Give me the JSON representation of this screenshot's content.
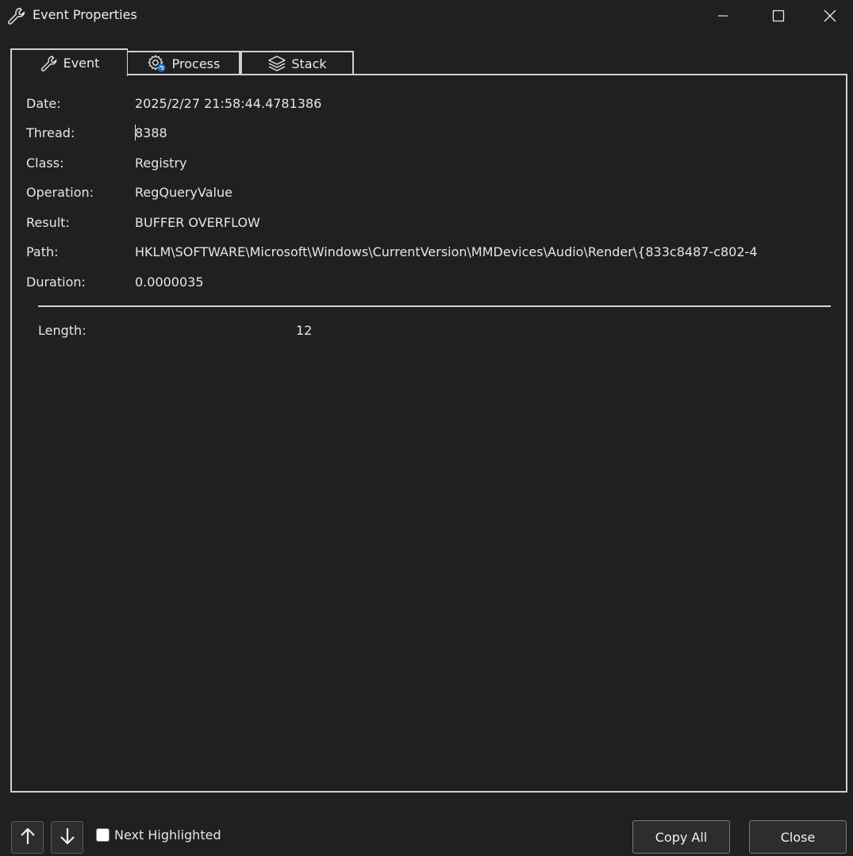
{
  "window": {
    "title": "Event Properties",
    "title_icon": "wrench-icon",
    "controls": [
      "minimize-icon",
      "maximize-icon",
      "close-icon"
    ]
  },
  "tabs": [
    {
      "label": "Event",
      "icon": "wrench-icon",
      "selected": true
    },
    {
      "label": "Process",
      "icon": "gear-icon",
      "selected": false
    },
    {
      "label": "Stack",
      "icon": "layers-icon",
      "selected": false
    }
  ],
  "properties": [
    {
      "label": "Date:",
      "value": "2025/2/27 21:58:44.4781386"
    },
    {
      "label": "Thread:",
      "value": "8388"
    },
    {
      "label": "Class:",
      "value": "Registry"
    },
    {
      "label": "Operation:",
      "value": "RegQueryValue"
    },
    {
      "label": "Result:",
      "value": "BUFFER OVERFLOW"
    },
    {
      "label": "Path:",
      "value": "HKLM\\SOFTWARE\\Microsoft\\Windows\\CurrentVersion\\MMDevices\\Audio\\Render\\{833c8487-c802-4"
    },
    {
      "label": "Duration:",
      "value": "0.0000035"
    }
  ],
  "detail": {
    "label": "Length:",
    "value": "12"
  },
  "footer": {
    "up_icon": "arrow-up-icon",
    "down_icon": "arrow-down-icon",
    "next_highlighted_label": "Next Highlighted",
    "next_highlighted_checked": false,
    "copy_all_label": "Copy All",
    "close_label": "Close"
  }
}
